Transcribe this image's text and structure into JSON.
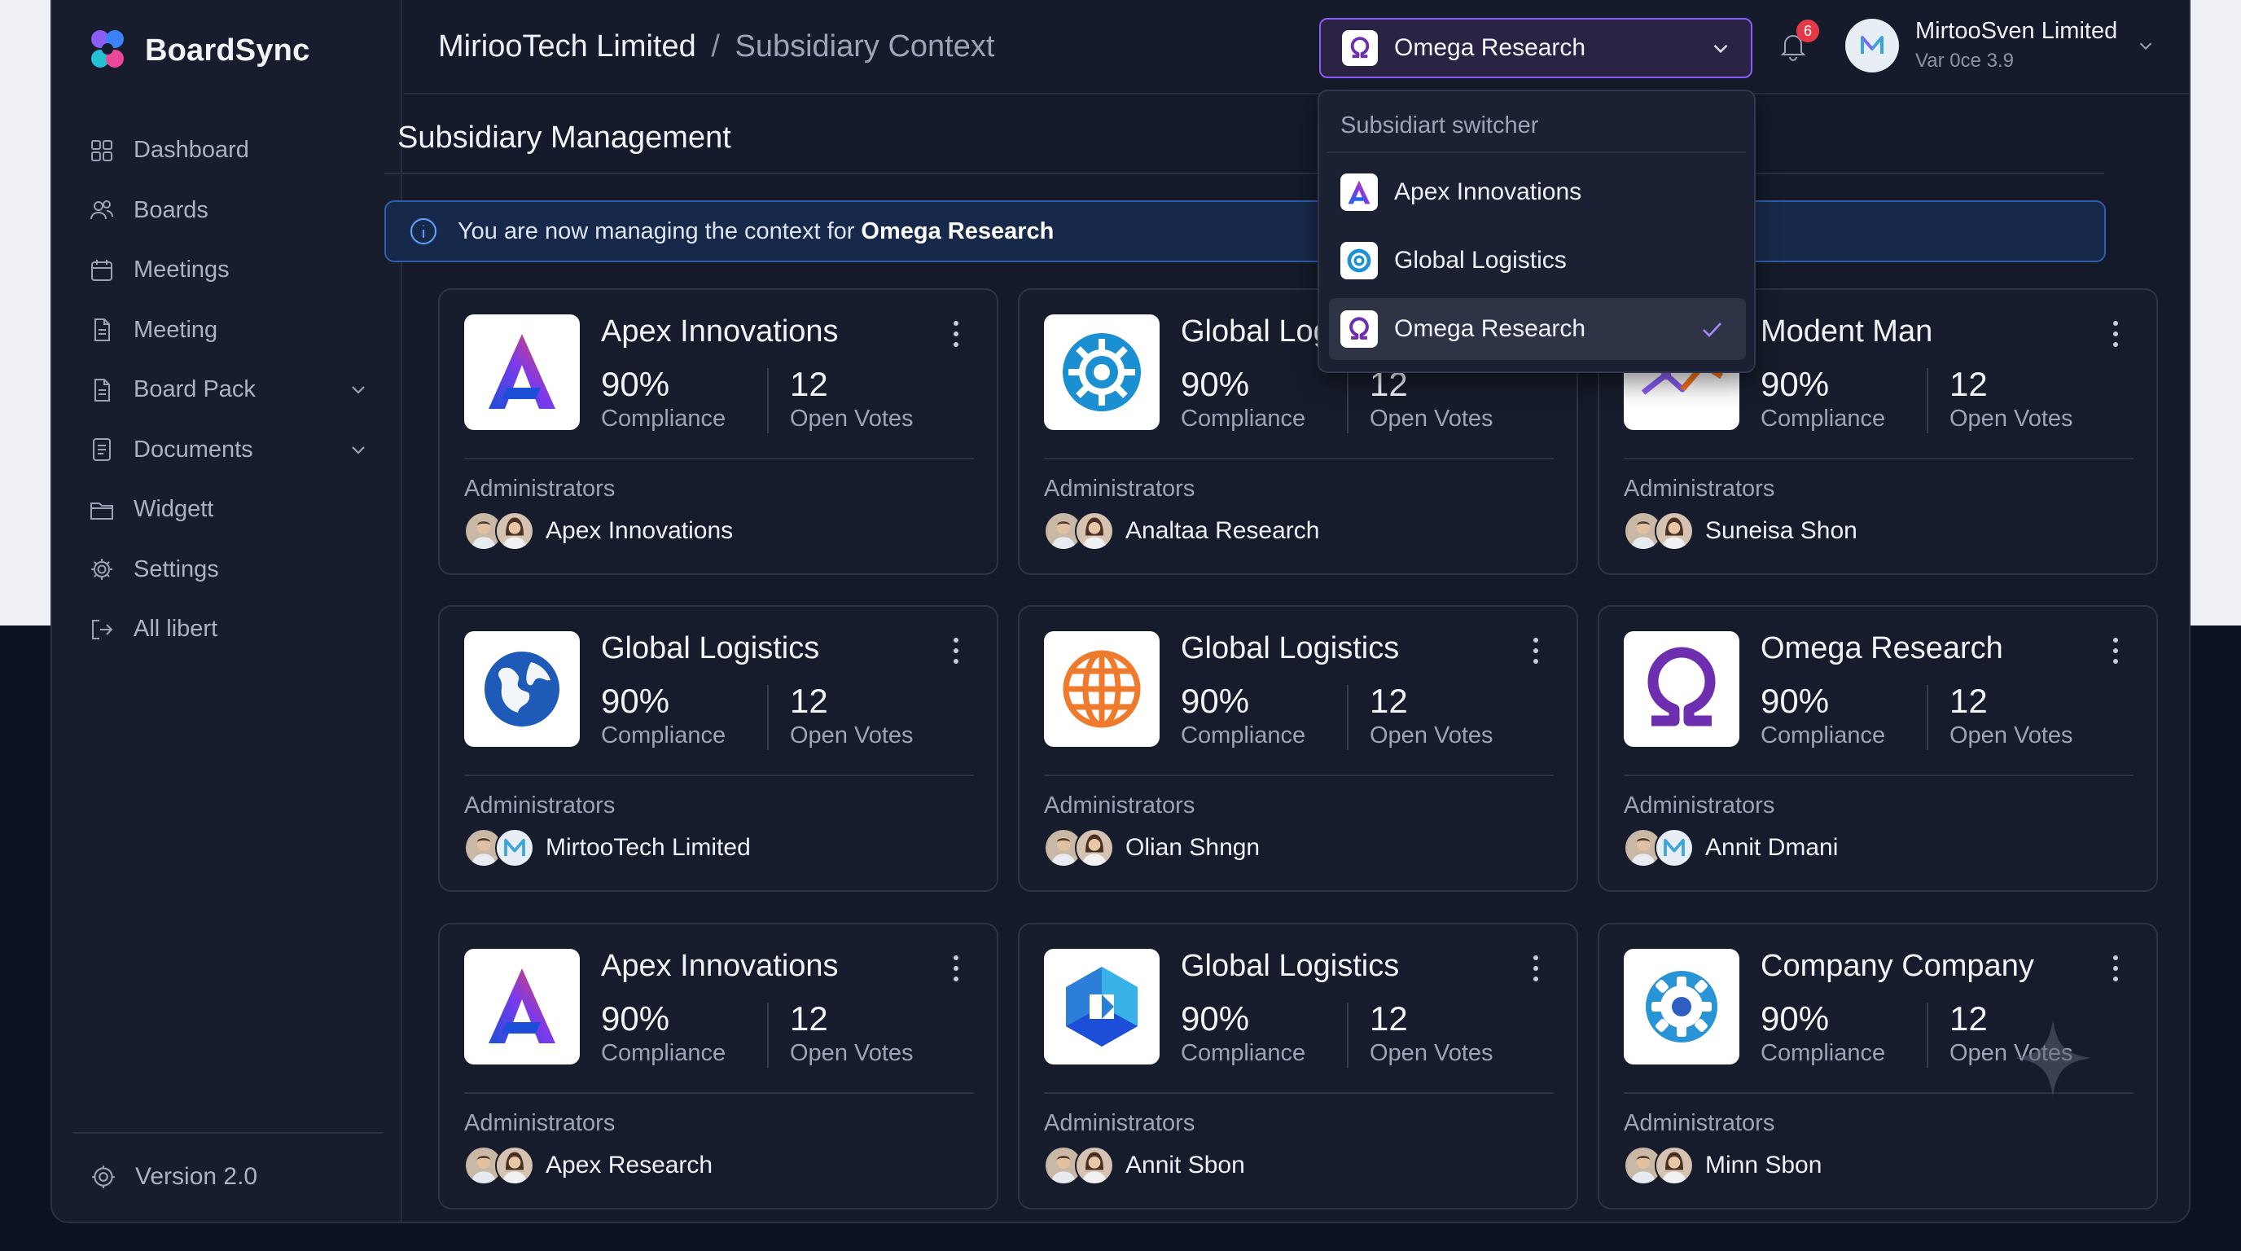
{
  "app": {
    "name": "BoardSync"
  },
  "header": {
    "breadcrumb_org": "MiriooTech Limited",
    "breadcrumb_sep": "/",
    "breadcrumb_context": "Subsidiary Context",
    "switcher_selected": "Omega Research",
    "notification_count": "6",
    "user_name": "MirtooSven Limited",
    "user_role": "Var 0ce 3.9"
  },
  "sidebar": {
    "items": [
      {
        "label": "Dashboard",
        "icon": "grid-icon"
      },
      {
        "label": "Boards",
        "icon": "users-icon"
      },
      {
        "label": "Meetings",
        "icon": "calendar-icon"
      },
      {
        "label": "Meeting",
        "icon": "document-icon"
      },
      {
        "label": "Board Pack",
        "icon": "document-icon",
        "has_chevron": true
      },
      {
        "label": "Documents",
        "icon": "file-list-icon",
        "has_chevron": true
      },
      {
        "label": "Widgett",
        "icon": "folder-icon"
      },
      {
        "label": "Settings",
        "icon": "gear-icon"
      },
      {
        "label": "All libert",
        "icon": "logout-icon"
      }
    ],
    "version": "Version 2.0"
  },
  "main": {
    "title": "Subsidiary Management",
    "banner_text": "You are now managing the context for",
    "banner_entity": "Omega Research",
    "labels": {
      "compliance": "Compliance",
      "open_votes": "Open Votes",
      "administrators": "Administrators"
    },
    "cards": [
      {
        "name": "Apex Innovations",
        "compliance": "90%",
        "votes": "12",
        "admin": "Apex Innovations",
        "logo": "apex-logo-icon"
      },
      {
        "name": "Global Logistics",
        "compliance": "90%",
        "votes": "12",
        "admin": "Analtaa Research",
        "logo": "gear-globe-logo-icon"
      },
      {
        "name": "Modent Man",
        "compliance": "90%",
        "votes": "12",
        "admin": "Suneisa Shon",
        "logo": "chart-line-logo-icon"
      },
      {
        "name": "Global Logistics",
        "compliance": "90%",
        "votes": "12",
        "admin": "MirtooTech Limited",
        "logo": "earth-logo-icon"
      },
      {
        "name": "Global Logistics",
        "compliance": "90%",
        "votes": "12",
        "admin": "Olian Shngn",
        "logo": "orange-globe-logo-icon"
      },
      {
        "name": "Omega Research",
        "compliance": "90%",
        "votes": "12",
        "admin": "Annit Dmani",
        "logo": "omega-logo-icon"
      },
      {
        "name": "Apex Innovations",
        "compliance": "90%",
        "votes": "12",
        "admin": "Apex Research",
        "logo": "apex-logo-icon"
      },
      {
        "name": "Global Logistics",
        "compliance": "90%",
        "votes": "12",
        "admin": "Annit Sbon",
        "logo": "hexagon-logo-icon"
      },
      {
        "name": "Company Company",
        "compliance": "90%",
        "votes": "12",
        "admin": "Minn Sbon",
        "logo": "gear-logo-icon"
      }
    ]
  },
  "dropdown": {
    "header": "Subsidiart switcher",
    "options": [
      {
        "label": "Apex Innovations",
        "selected": false
      },
      {
        "label": "Global Logistics",
        "selected": false
      },
      {
        "label": "Omega Research",
        "selected": true
      }
    ]
  },
  "colors": {
    "accent": "#8b5cf6",
    "info": "#2f5fa8",
    "badge": "#e53946",
    "omega": "#6d2fb0"
  }
}
